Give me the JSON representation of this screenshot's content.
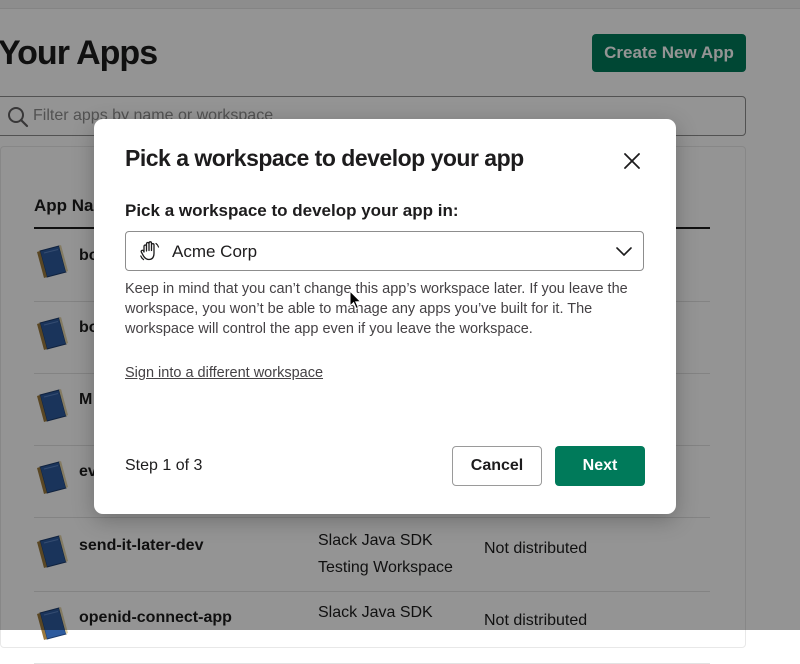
{
  "page": {
    "title": "Your Apps",
    "create_button": "Create New App",
    "filter_placeholder": "Filter apps by name or workspace",
    "column_header": "App Name",
    "apps": [
      {
        "name": "bo",
        "workspace": "",
        "distribution": ""
      },
      {
        "name": "bo",
        "workspace": "",
        "distribution": ""
      },
      {
        "name": "M",
        "workspace": "",
        "distribution": ""
      },
      {
        "name": "ev",
        "workspace": "",
        "distribution": ""
      },
      {
        "name": "send-it-later-dev",
        "workspace": "Slack Java SDK\nTesting Workspace",
        "distribution": "Not distributed"
      },
      {
        "name": "openid-connect-app",
        "workspace": "Slack Java SDK",
        "distribution": "Not distributed"
      }
    ]
  },
  "modal": {
    "title": "Pick a workspace to develop your app",
    "field_label": "Pick a workspace to develop your app in:",
    "selected_workspace": "Acme Corp",
    "help_text": "Keep in mind that you can’t change this app’s workspace later. If you leave the workspace, you won’t be able to manage any apps you’ve built for it. The workspace will control the app even if you leave the workspace.",
    "sign_in_link": "Sign into a different workspace",
    "step": "Step 1 of 3",
    "cancel_label": "Cancel",
    "next_label": "Next"
  },
  "icons": {
    "close": "close-icon",
    "chevron": "chevron-down-icon",
    "workspace": "waving-hand-icon",
    "search": "search-icon",
    "app": "book-icon"
  },
  "colors": {
    "primary": "#007a5a",
    "text": "#1d1c1d",
    "overlay": "rgba(0,0,0,0.42)"
  }
}
